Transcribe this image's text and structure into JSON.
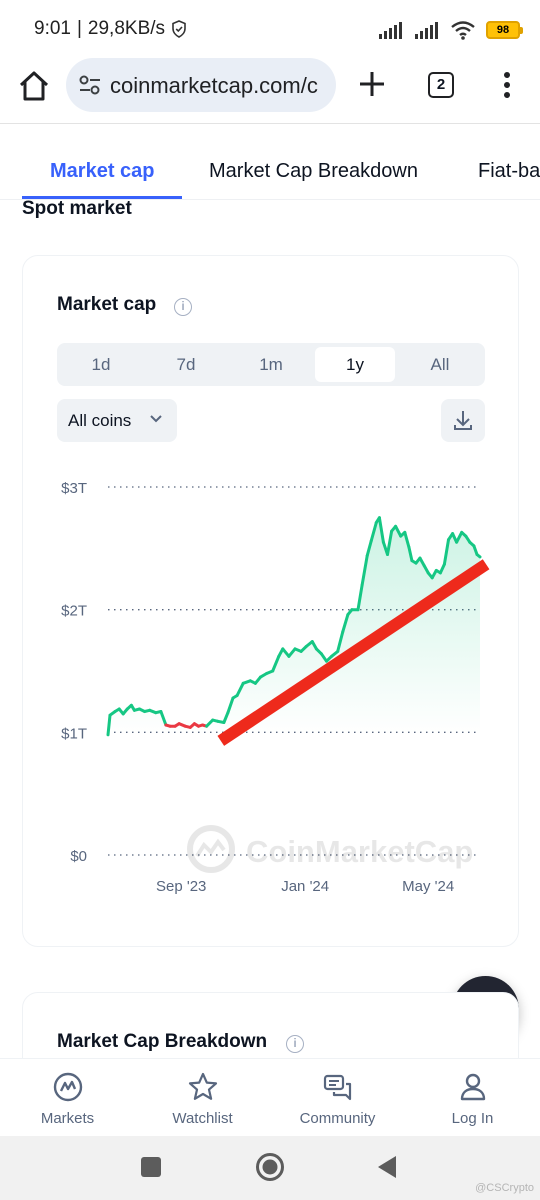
{
  "status_bar": {
    "time": "9:01",
    "separator": "|",
    "net_speed": "29,8KB/s",
    "battery": "98"
  },
  "browser": {
    "url": "coinmarketcap.com/c",
    "tab_count": "2"
  },
  "tabs": [
    {
      "label": "Market cap",
      "active": true
    },
    {
      "label": "Market Cap Breakdown",
      "active": false
    },
    {
      "label": "Fiat-ba",
      "active": false
    }
  ],
  "section_title": "Spot market",
  "card": {
    "title": "Market cap",
    "info_icon": "i",
    "ranges": [
      "1d",
      "7d",
      "1m",
      "1y",
      "All"
    ],
    "selected_range": "1y",
    "coins_select": "All coins",
    "watermark": "CoinMarketCap"
  },
  "chart_data": {
    "type": "area",
    "ylabel": "",
    "y_ticks": [
      "$0",
      "$1T",
      "$2T",
      "$3T"
    ],
    "ylim": [
      0,
      3
    ],
    "y_unit": "trillion USD",
    "x_ticks": [
      "Sep '23",
      "Jan '24",
      "May '24"
    ],
    "x_tick_dates": [
      "2023-09-01",
      "2024-01-01",
      "2024-05-01"
    ],
    "x_range": [
      "2023-06-21",
      "2024-06-21"
    ],
    "series": [
      {
        "color": "#16c784",
        "negative_color": "#ea3943",
        "points": [
          [
            "2023-06-21",
            0.98
          ],
          [
            "2023-06-23",
            1.14
          ],
          [
            "2023-06-28",
            1.17
          ],
          [
            "2023-07-02",
            1.19
          ],
          [
            "2023-07-06",
            1.15
          ],
          [
            "2023-07-10",
            1.19
          ],
          [
            "2023-07-14",
            1.22
          ],
          [
            "2023-07-17",
            1.18
          ],
          [
            "2023-07-22",
            1.19
          ],
          [
            "2023-07-27",
            1.17
          ],
          [
            "2023-08-01",
            1.18
          ],
          [
            "2023-08-07",
            1.16
          ],
          [
            "2023-08-12",
            1.17
          ],
          [
            "2023-08-17",
            1.06
          ],
          [
            "2023-08-21",
            1.05
          ],
          [
            "2023-08-26",
            1.05
          ],
          [
            "2023-08-30",
            1.07
          ],
          [
            "2023-09-05",
            1.05
          ],
          [
            "2023-09-10",
            1.04
          ],
          [
            "2023-09-14",
            1.07
          ],
          [
            "2023-09-18",
            1.05
          ],
          [
            "2023-09-22",
            1.06
          ],
          [
            "2023-09-26",
            1.05
          ],
          [
            "2023-10-02",
            1.1
          ],
          [
            "2023-10-07",
            1.09
          ],
          [
            "2023-10-13",
            1.08
          ],
          [
            "2023-10-17",
            1.16
          ],
          [
            "2023-10-22",
            1.28
          ],
          [
            "2023-10-26",
            1.3
          ],
          [
            "2023-11-01",
            1.4
          ],
          [
            "2023-11-08",
            1.42
          ],
          [
            "2023-11-13",
            1.4
          ],
          [
            "2023-11-18",
            1.45
          ],
          [
            "2023-11-24",
            1.48
          ],
          [
            "2023-11-30",
            1.5
          ],
          [
            "2023-12-06",
            1.62
          ],
          [
            "2023-12-10",
            1.68
          ],
          [
            "2023-12-16",
            1.62
          ],
          [
            "2023-12-22",
            1.68
          ],
          [
            "2023-12-28",
            1.66
          ],
          [
            "2024-01-02",
            1.7
          ],
          [
            "2024-01-08",
            1.74
          ],
          [
            "2024-01-12",
            1.68
          ],
          [
            "2024-01-17",
            1.64
          ],
          [
            "2024-01-22",
            1.58
          ],
          [
            "2024-01-27",
            1.62
          ],
          [
            "2024-02-02",
            1.66
          ],
          [
            "2024-02-07",
            1.82
          ],
          [
            "2024-02-12",
            1.96
          ],
          [
            "2024-02-16",
            2.0
          ],
          [
            "2024-02-22",
            2.0
          ],
          [
            "2024-02-26",
            2.2
          ],
          [
            "2024-03-02",
            2.44
          ],
          [
            "2024-03-06",
            2.56
          ],
          [
            "2024-03-11",
            2.71
          ],
          [
            "2024-03-14",
            2.75
          ],
          [
            "2024-03-18",
            2.55
          ],
          [
            "2024-03-22",
            2.45
          ],
          [
            "2024-03-26",
            2.64
          ],
          [
            "2024-03-30",
            2.68
          ],
          [
            "2024-04-04",
            2.6
          ],
          [
            "2024-04-08",
            2.63
          ],
          [
            "2024-04-12",
            2.51
          ],
          [
            "2024-04-15",
            2.4
          ],
          [
            "2024-04-19",
            2.38
          ],
          [
            "2024-04-23",
            2.42
          ],
          [
            "2024-04-27",
            2.36
          ],
          [
            "2024-05-01",
            2.3
          ],
          [
            "2024-05-05",
            2.26
          ],
          [
            "2024-05-09",
            2.32
          ],
          [
            "2024-05-13",
            2.3
          ],
          [
            "2024-05-17",
            2.37
          ],
          [
            "2024-05-21",
            2.57
          ],
          [
            "2024-05-25",
            2.62
          ],
          [
            "2024-05-29",
            2.55
          ],
          [
            "2024-06-03",
            2.63
          ],
          [
            "2024-06-07",
            2.6
          ],
          [
            "2024-06-11",
            2.55
          ],
          [
            "2024-06-15",
            2.52
          ],
          [
            "2024-06-18",
            2.45
          ],
          [
            "2024-06-21",
            2.43
          ]
        ]
      }
    ],
    "annotation": {
      "type": "trend-line",
      "color": "#ee2a1c",
      "from": [
        "2023-10-10",
        0.93
      ],
      "to": [
        "2024-06-27",
        2.37
      ]
    },
    "grid": true
  },
  "card2": {
    "title": "Market Cap Breakdown",
    "info_icon": "i"
  },
  "bottom_nav": [
    {
      "label": "Markets",
      "icon": "markets-icon"
    },
    {
      "label": "Watchlist",
      "icon": "star-icon"
    },
    {
      "label": "Community",
      "icon": "chat-icon"
    },
    {
      "label": "Log In",
      "icon": "user-icon"
    }
  ],
  "credit": "@CSCrypto"
}
